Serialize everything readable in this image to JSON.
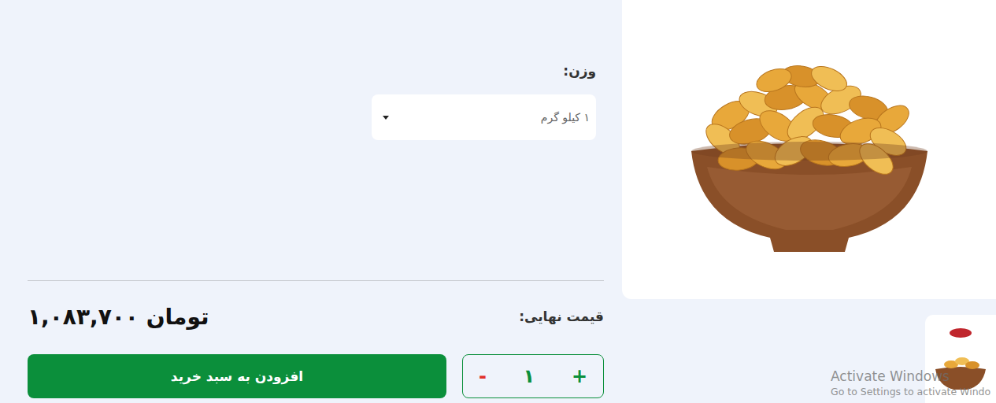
{
  "options": [
    {
      "label": "وزن:",
      "value": "۱ کیلو گرم"
    }
  ],
  "price": {
    "label": "قیمت نهایی:",
    "value": "۱,۰۸۳,۷۰۰ تومان"
  },
  "quantity": {
    "plus": "+",
    "value": "۱",
    "minus": "-"
  },
  "add_to_cart": "افزودن به سبد خرید",
  "watermark": {
    "title": "Activate Windows",
    "subtitle": "Go to Settings to activate Windo"
  }
}
